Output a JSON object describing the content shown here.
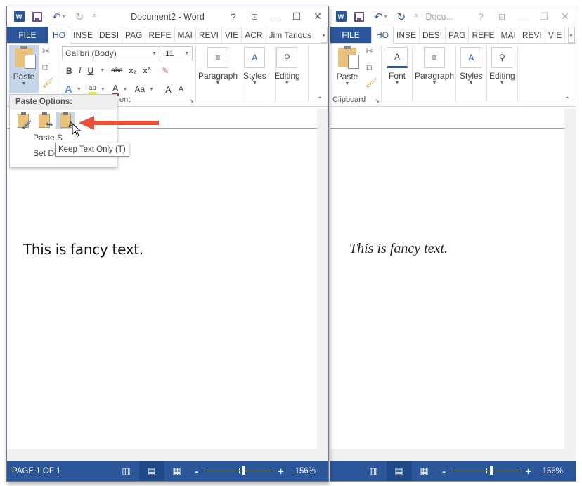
{
  "left_window": {
    "title": "Document2 - Word",
    "quick_access": {
      "undo": "↶",
      "redo": "↻",
      "customize": "⩡"
    },
    "window_controls": {
      "help": "?",
      "ribbon_display": "⊡",
      "minimize": "—",
      "maximize": "☐",
      "close": "✕"
    },
    "tabs": [
      "FILE",
      "HO",
      "INSE",
      "DESI",
      "PAG",
      "REFE",
      "MAI",
      "REVI",
      "VIE",
      "ACR"
    ],
    "active_tab": "HO",
    "user": "Jim Tanous",
    "ribbon": {
      "paste_label": "Paste",
      "font_name": "Calibri (Body)",
      "font_size": "11",
      "format_buttons": [
        "B",
        "I",
        "U",
        "abc",
        "x₂",
        "x²"
      ],
      "font_row2": [
        "A",
        "ab",
        "A",
        "Aa",
        "A",
        "A"
      ],
      "font_group_label_partial": "ont",
      "groups": [
        "Paragraph",
        "Styles",
        "Editing"
      ]
    },
    "paste_menu": {
      "header": "Paste Options:",
      "options": [
        "Keep Source Formatting",
        "Merge Formatting",
        "Keep Text Only"
      ],
      "items": [
        "Paste Special...",
        "Set Default Paste..."
      ],
      "item_visible_partial": [
        "Paste S",
        "Set De"
      ],
      "tooltip": "Keep Text Only (T)"
    },
    "document_text": "This is fancy text.",
    "status": {
      "page": "PAGE 1 OF 1",
      "zoom_percent": "156%",
      "zoom_minus": "-",
      "zoom_plus": "+"
    }
  },
  "right_window": {
    "title": "Docu...",
    "tabs": [
      "FILE",
      "HO",
      "INSE",
      "DESI",
      "PAG",
      "REFE",
      "MAI",
      "REVI",
      "VIE"
    ],
    "active_tab": "HO",
    "ribbon": {
      "paste_label": "Paste",
      "clipboard_label": "Clipboard",
      "groups": [
        "Font",
        "Paragraph",
        "Styles",
        "Editing"
      ]
    },
    "document_text": "This is fancy text.",
    "status": {
      "zoom_percent": "156%",
      "zoom_minus": "-",
      "zoom_plus": "+"
    }
  },
  "colors": {
    "word_blue": "#2b579a",
    "arrow_red": "#e8503a",
    "hover_blue": "#c5d5ea"
  }
}
